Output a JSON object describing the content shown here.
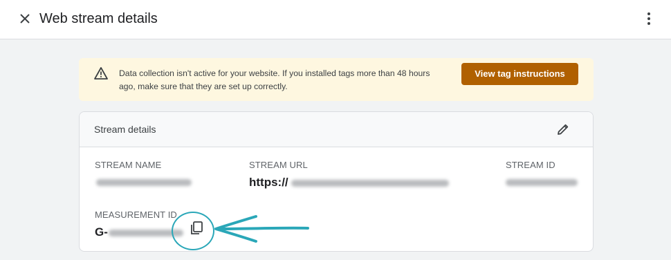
{
  "header": {
    "title": "Web stream details",
    "close_icon": "close-icon",
    "more_icon": "more-vert-icon"
  },
  "banner": {
    "icon": "warning-icon",
    "message": "Data collection isn't active for your website. If you installed tags more than 48 hours ago, make sure that they are set up correctly.",
    "button_label": "View tag instructions",
    "button_color": "#b06000",
    "background": "#fef7e0"
  },
  "card": {
    "title": "Stream details",
    "edit_icon": "edit-pencil-icon",
    "fields": {
      "stream_name": {
        "label": "STREAM NAME",
        "value_redacted": true
      },
      "stream_url": {
        "label": "STREAM URL",
        "value_prefix": "https://",
        "value_redacted": true
      },
      "stream_id": {
        "label": "STREAM ID",
        "value_redacted": true
      },
      "measurement_id": {
        "label": "MEASUREMENT ID",
        "value_prefix": "G-",
        "value_redacted": true,
        "copy_icon": "copy-icon"
      }
    }
  },
  "annotation": {
    "color": "#2aa7b8"
  }
}
